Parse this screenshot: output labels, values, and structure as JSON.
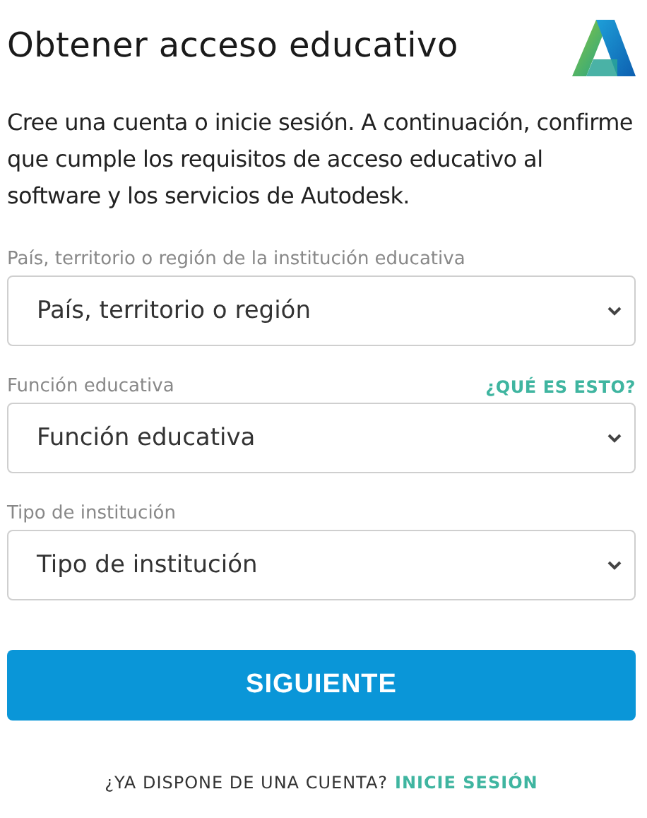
{
  "title": "Obtener acceso educativo",
  "intro": "Cree una cuenta o inicie sesión. A continuación, confirme que cumple los requisitos de acceso educativo al software y los servicios de Autodesk.",
  "fields": [
    {
      "label": "País, territorio o región de la institución educativa",
      "value": "País, territorio o región"
    },
    {
      "label": "Función educativa",
      "help": "¿QUÉ ES ESTO?",
      "value": "Función educativa"
    },
    {
      "label": "Tipo de institución",
      "value": "Tipo de institución"
    }
  ],
  "submit": "SIGUIENTE",
  "footer": {
    "text": "¿YA DISPONE DE UNA CUENTA?",
    "link": "INICIE SESIÓN"
  }
}
